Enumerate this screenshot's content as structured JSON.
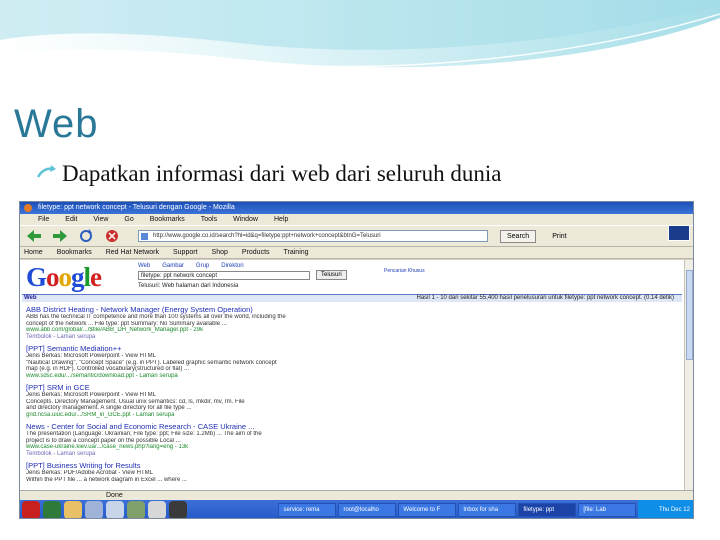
{
  "slide": {
    "title": "Web",
    "bullet": "Dapatkan informasi dari web dari seluruh dunia",
    "colors": {
      "title": "#2a7898",
      "header_wave": "#5ec3d6"
    }
  },
  "browser": {
    "window_title": "filetype: ppt network concept - Telusuri dengan Google - Mozilla",
    "menu": [
      "File",
      "Edit",
      "View",
      "Go",
      "Bookmarks",
      "Tools",
      "Window",
      "Help"
    ],
    "nav_icons": [
      "back-icon",
      "forward-icon",
      "reload-icon",
      "stop-icon"
    ],
    "url": "http://www.google.co.id/search?hl=id&q=filetype:ppt+network+concept&btnG=Telusuri",
    "search_button": "Search",
    "print_button": "Print",
    "bookmarks": [
      "Home",
      "Bookmarks",
      "Red Hat Network",
      "Support",
      "Shop",
      "Products",
      "Training"
    ],
    "status": "Done"
  },
  "google": {
    "tabs": [
      "Web",
      "Gambar",
      "Grup",
      "Direktori"
    ],
    "query": "filetype: ppt network concept",
    "search_button": "Telusuri",
    "prefs_link": "Pencarian Khusus",
    "radio_text": "Telusuri: Web   halaman dari Indonesia",
    "result_count_label": "Web",
    "result_summary": "Hasil 1 - 10 dari sekitar 55,400 hasil penelusuran untuk filetype: ppt network concept. (0.14 detik)",
    "results": [
      {
        "title": "ABB District Heating - Network Manager (Energy System Operation)",
        "lines": [
          "ABB has the technical IT competence and more than 100 systems all over the world, including the",
          "concept of the network ... File type: ppt Summary: No Summary available ..."
        ],
        "url": "www.abb.com/global/.../$file/ABB_DH_Network_Manager.ppt - 29k",
        "links": "Tembolok - Laman serupa"
      },
      {
        "title": "[PPT] Semantic Mediation++",
        "lines": [
          "Jenis Berkas: Microsoft Powerpoint - View HTML",
          "\"Nautical Drawing\", \"Concept Space\" (e.g. in PPT). Labeled graphic semantic network concept",
          "map (e.g. in RDF). Controlled vocabulary(structured or flat) ..."
        ],
        "url": "www.sdsc.edu/.../semantic/download.ppt - Laman serupa",
        "links": ""
      },
      {
        "title": "[PPT] SRM in GCE",
        "lines": [
          "Jenis Berkas: Microsoft Powerpoint - View HTML",
          "Concepts. Directory Management. Usual unix semantics: cd, ls, mkdir, mv, rm. File",
          "and directory management. A single directory for all file type ..."
        ],
        "url": "grid.ncsa.uiuc.edu/.../SRM_in_GCE.ppt - Laman serupa",
        "links": ""
      },
      {
        "title": "News - Center for Social and Economic Research - CASE Ukraine ...",
        "lines": [
          "The presentation (Language: Ukrainian; File type: ppt; File size: 1.2Mb) ... The aim of the",
          "project is to draw a concept paper on the possible Local ..."
        ],
        "url": "www.case-ukraine.kiev.ua/.../case_news.php?lang=eng - 13k",
        "links": "Tembolok - Laman serupa"
      },
      {
        "title": "[PPT] Business Writing for Results",
        "lines": [
          "Jenis Berkas: PDF/Adobe Acrobat - View HTML",
          "Within the PPT file ... a network diagram in Excel ... where ..."
        ],
        "url": "",
        "links": ""
      }
    ]
  },
  "taskbar": {
    "tasks": [
      "service: rema",
      "root@localho",
      "Welcome to F",
      "Inbox for sha",
      "filetype: ppt",
      "[file: Lab"
    ],
    "clock": "Thu Dec 12"
  }
}
